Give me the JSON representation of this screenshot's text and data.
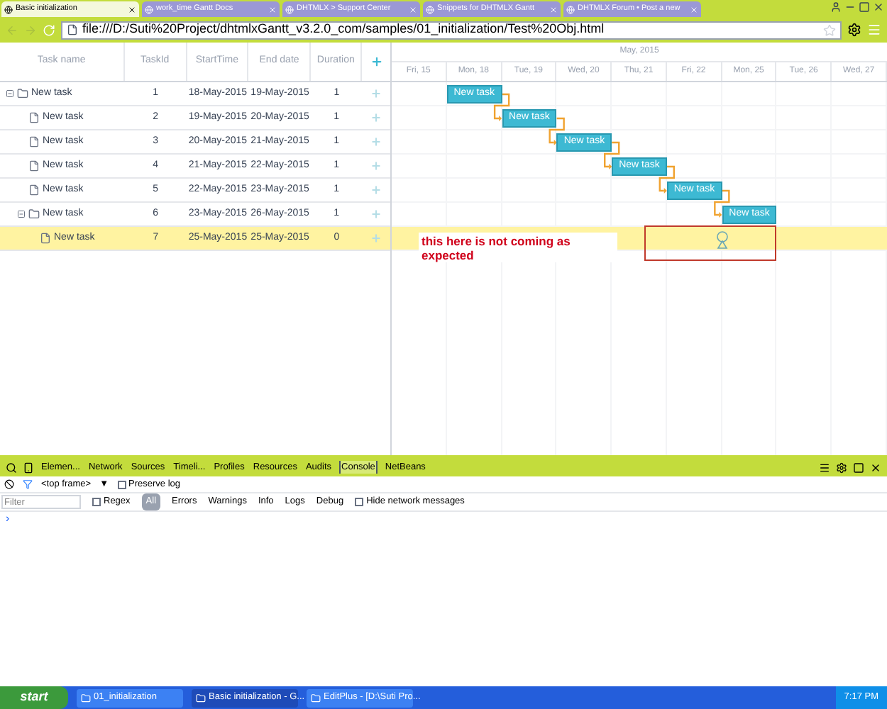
{
  "browser": {
    "tabs": [
      {
        "label": "Basic initialization",
        "selected": true
      },
      {
        "label": "work_time Gantt Docs",
        "selected": false
      },
      {
        "label": "DHTMLX > Support Center",
        "selected": false
      },
      {
        "label": "Snippets for DHTMLX Gantt",
        "selected": false
      },
      {
        "label": "DHTMLX Forum • Post a new",
        "selected": false
      }
    ],
    "address": "file:///D:/Suti%20Project/dhtmlxGantt_v3.2.0_com/samples/01_initialization/Test%20Obj.html"
  },
  "gantt": {
    "columns": [
      "Task name",
      "TaskId",
      "StartTime",
      "End date",
      "Duration"
    ],
    "month": "May, 2015",
    "days": [
      "Fri, 15",
      "Mon, 18",
      "Tue, 19",
      "Wed, 20",
      "Thu, 21",
      "Fri, 22",
      "Mon, 25",
      "Tue, 26",
      "Wed, 27"
    ],
    "tasks": [
      {
        "kind": "project",
        "name": "New task",
        "id": "1",
        "start": "18-May-2015",
        "end": "19-May-2015",
        "duration": "1",
        "bar_label": "New task",
        "expanded": true,
        "selected": false,
        "children": [
          {
            "kind": "task",
            "name": "New task",
            "id": "2",
            "start": "19-May-2015",
            "end": "20-May-2015",
            "duration": "1",
            "bar_label": "New task",
            "selected": false
          },
          {
            "kind": "task",
            "name": "New task",
            "id": "3",
            "start": "20-May-2015",
            "end": "21-May-2015",
            "duration": "1",
            "bar_label": "New task",
            "selected": false
          },
          {
            "kind": "task",
            "name": "New task",
            "id": "4",
            "start": "21-May-2015",
            "end": "22-May-2015",
            "duration": "1",
            "bar_label": "New task",
            "selected": false
          },
          {
            "kind": "task",
            "name": "New task",
            "id": "5",
            "start": "22-May-2015",
            "end": "23-May-2015",
            "duration": "1",
            "bar_label": "New task",
            "selected": false
          },
          {
            "kind": "project",
            "name": "New task",
            "id": "6",
            "start": "23-May-2015",
            "end": "26-May-2015",
            "duration": "1",
            "bar_label": "New task",
            "expanded": true,
            "selected": false,
            "children": [
              {
                "kind": "milestone",
                "name": "New task",
                "id": "7",
                "start": "25-May-2015",
                "end": "25-May-2015",
                "duration": "0",
                "selected": true
              }
            ]
          }
        ]
      }
    ]
  },
  "annotation": "this here is not coming as expected",
  "devtools": {
    "tabs": [
      {
        "label": "Elemen...",
        "selected": false
      },
      {
        "label": "Network",
        "selected": false
      },
      {
        "label": "Sources",
        "selected": false
      },
      {
        "label": "Timeli...",
        "selected": false
      },
      {
        "label": "Profiles",
        "selected": false
      },
      {
        "label": "Resources",
        "selected": false
      },
      {
        "label": "Audits",
        "selected": false
      },
      {
        "label": "Console",
        "selected": true
      },
      {
        "label": "NetBeans",
        "selected": false
      }
    ],
    "context": "<top frame>",
    "context_caret": "▼",
    "preserve_log": {
      "label": "Preserve log",
      "checked": false
    },
    "filter_placeholder": "Filter",
    "regex": {
      "label": "Regex",
      "checked": false
    },
    "levels": [
      {
        "label": "All",
        "selected": true
      },
      {
        "label": "Errors",
        "selected": false
      },
      {
        "label": "Warnings",
        "selected": false
      },
      {
        "label": "Info",
        "selected": false
      },
      {
        "label": "Logs",
        "selected": false
      },
      {
        "label": "Debug",
        "selected": false
      }
    ],
    "hide_network": {
      "label": "Hide network messages",
      "checked": false
    },
    "prompt": "›"
  },
  "taskbar": {
    "start": "start",
    "items": [
      {
        "label": "01_initialization",
        "selected": false
      },
      {
        "label": "Basic initialization - G...",
        "selected": true
      },
      {
        "label": "EditPlus - [D:\\Suti Pro...",
        "selected": false
      }
    ],
    "clock": "7:17 PM"
  }
}
